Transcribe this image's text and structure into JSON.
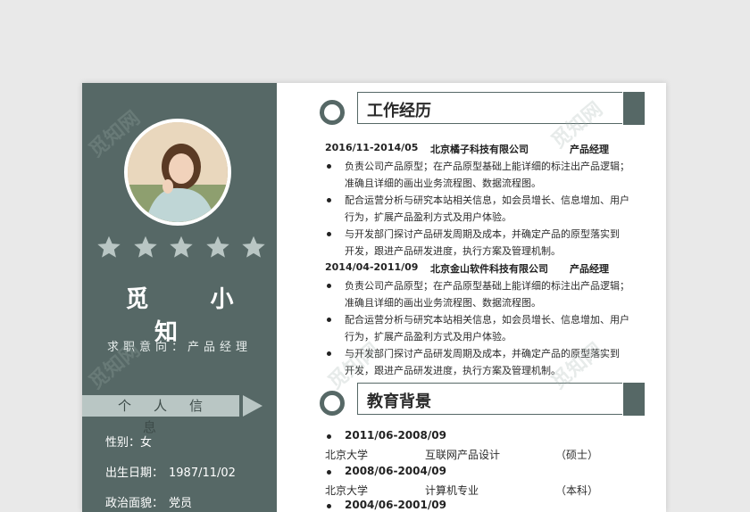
{
  "sidebar": {
    "name": "觅 小 知",
    "objective": "求职意向：产品经理",
    "personal_section": "个人信息",
    "info": [
      {
        "label": "性别：",
        "value": "女"
      },
      {
        "label": "出生日期：",
        "value": "1987/11/02"
      },
      {
        "label": "政治面貌：",
        "value": "党员"
      }
    ],
    "stars": 5
  },
  "work": {
    "title": "工作经历",
    "jobs": [
      {
        "period": "2016/11-2014/05",
        "company": "北京橘子科技有限公司",
        "role": "产品经理",
        "bullets": [
          {
            "l1": "负责公司产品原型；在产品原型基础上能详细的标注出产品逻辑；",
            "l2": "准确且详细的画出业务流程图、数据流程图。"
          },
          {
            "l1": "配合运营分析与研究本站相关信息，如会员增长、信息增加、用户",
            "l2": "行为，扩展产品盈利方式及用户体验。"
          },
          {
            "l1": "与开发部门探讨产品研发周期及成本，并确定产品的原型落实到",
            "l2": "开发，跟进产品研发进度，执行方案及管理机制。"
          }
        ]
      },
      {
        "period": "2014/04-2011/09",
        "company": "北京金山软件科技有限公司",
        "role": "产品经理",
        "bullets": [
          {
            "l1": "负责公司产品原型；在产品原型基础上能详细的标注出产品逻辑；",
            "l2": "准确且详细的画出业务流程图、数据流程图。"
          },
          {
            "l1": "配合运营分析与研究本站相关信息，如会员增长、信息增加、用户",
            "l2": "行为，扩展产品盈利方式及用户体验。"
          },
          {
            "l1": "与开发部门探讨产品研发周期及成本，并确定产品的原型落实到",
            "l2": "开发，跟进产品研发进度，执行方案及管理机制。"
          }
        ]
      }
    ]
  },
  "education": {
    "title": "教育背景",
    "items": [
      {
        "period": "2011/06-2008/09",
        "school": "北京大学",
        "major": "互联网产品设计",
        "degree": "（硕士）"
      },
      {
        "period": "2008/06-2004/09",
        "school": "北京大学",
        "major": "计算机专业",
        "degree": "（本科）"
      },
      {
        "period": "2004/06-2001/09"
      }
    ]
  },
  "watermark": "觅知网",
  "colors": {
    "accent": "#566866",
    "light_accent": "#b9c6c4"
  },
  "icons": {
    "star": "star-icon",
    "section": "ring-icon",
    "arrow": "arrow-right-icon"
  }
}
